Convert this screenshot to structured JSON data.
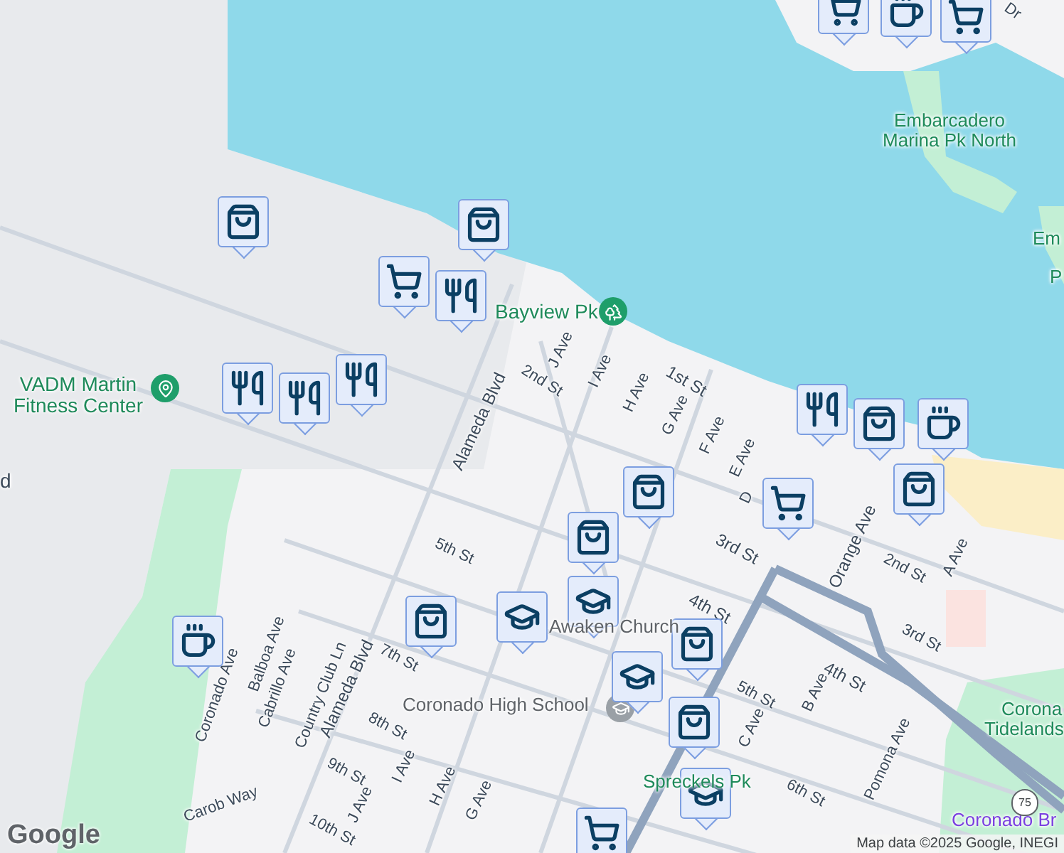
{
  "labels": [
    {
      "text": "Dr",
      "kind": "street"
    },
    {
      "text": "Embarcadero Marina Pk North",
      "kind": "park"
    },
    {
      "text": "Em",
      "kind": "park"
    },
    {
      "text": "P",
      "kind": "park"
    },
    {
      "text": "Bayview Pk",
      "kind": "park"
    },
    {
      "text": "VADM Martin Fitness Center",
      "kind": "park"
    },
    {
      "text": "d",
      "kind": "street"
    },
    {
      "text": "Alameda Blvd",
      "kind": "street"
    },
    {
      "text": "2nd St",
      "kind": "street"
    },
    {
      "text": "J Ave",
      "kind": "street"
    },
    {
      "text": "I Ave",
      "kind": "street"
    },
    {
      "text": "H Ave",
      "kind": "street"
    },
    {
      "text": "G Ave",
      "kind": "street"
    },
    {
      "text": "F Ave",
      "kind": "street"
    },
    {
      "text": "E Ave",
      "kind": "street"
    },
    {
      "text": "D",
      "kind": "street"
    },
    {
      "text": "1st St",
      "kind": "street"
    },
    {
      "text": "Orange Ave",
      "kind": "street"
    },
    {
      "text": "2nd St",
      "kind": "street"
    },
    {
      "text": "A Ave",
      "kind": "street"
    },
    {
      "text": "3rd St",
      "kind": "street"
    },
    {
      "text": "4th St",
      "kind": "street"
    },
    {
      "text": "3rd St",
      "kind": "street"
    },
    {
      "text": "4th St",
      "kind": "street"
    },
    {
      "text": "5th St",
      "kind": "street"
    },
    {
      "text": "5th St",
      "kind": "street"
    },
    {
      "text": "B Ave",
      "kind": "street"
    },
    {
      "text": "C Ave",
      "kind": "street"
    },
    {
      "text": "6th St",
      "kind": "street"
    },
    {
      "text": "Pomona Ave",
      "kind": "street"
    },
    {
      "text": "7th St",
      "kind": "street"
    },
    {
      "text": "8th St",
      "kind": "street"
    },
    {
      "text": "9th St",
      "kind": "street"
    },
    {
      "text": "10th St",
      "kind": "street"
    },
    {
      "text": "Coronado Ave",
      "kind": "street"
    },
    {
      "text": "Balboa Ave",
      "kind": "street"
    },
    {
      "text": "Cabrillo Ave",
      "kind": "street"
    },
    {
      "text": "Country Club Ln",
      "kind": "street"
    },
    {
      "text": "Alameda Blvd",
      "kind": "street"
    },
    {
      "text": "I Ave",
      "kind": "street"
    },
    {
      "text": "H Ave",
      "kind": "street"
    },
    {
      "text": "G Ave",
      "kind": "street"
    },
    {
      "text": "J Ave",
      "kind": "street"
    },
    {
      "text": "Carob Way",
      "kind": "street"
    },
    {
      "text": "Awaken Church",
      "kind": "place"
    },
    {
      "text": "Coronado High School",
      "kind": "place"
    },
    {
      "text": "Spreckels Pk",
      "kind": "park"
    },
    {
      "text": "Corona",
      "kind": "park"
    },
    {
      "text": "Tidelands",
      "kind": "park"
    },
    {
      "text": "Coronado Br",
      "kind": "landmark"
    }
  ],
  "markers": [
    {
      "kind": "shop"
    },
    {
      "kind": "shop"
    },
    {
      "kind": "cart"
    },
    {
      "kind": "food"
    },
    {
      "kind": "food"
    },
    {
      "kind": "food"
    },
    {
      "kind": "food"
    },
    {
      "kind": "coffee"
    },
    {
      "kind": "shop"
    },
    {
      "kind": "school"
    },
    {
      "kind": "school"
    },
    {
      "kind": "shop"
    },
    {
      "kind": "shop"
    },
    {
      "kind": "shop"
    },
    {
      "kind": "school"
    },
    {
      "kind": "shop"
    },
    {
      "kind": "school"
    },
    {
      "kind": "cart"
    },
    {
      "kind": "food"
    },
    {
      "kind": "cart"
    },
    {
      "kind": "shop"
    },
    {
      "kind": "coffee"
    },
    {
      "kind": "shop"
    },
    {
      "kind": "cart"
    },
    {
      "kind": "coffee"
    },
    {
      "kind": "cart"
    }
  ],
  "highway_shield": "75",
  "logo": "Google",
  "attribution": "Map data ©2025 Google, INEGI"
}
